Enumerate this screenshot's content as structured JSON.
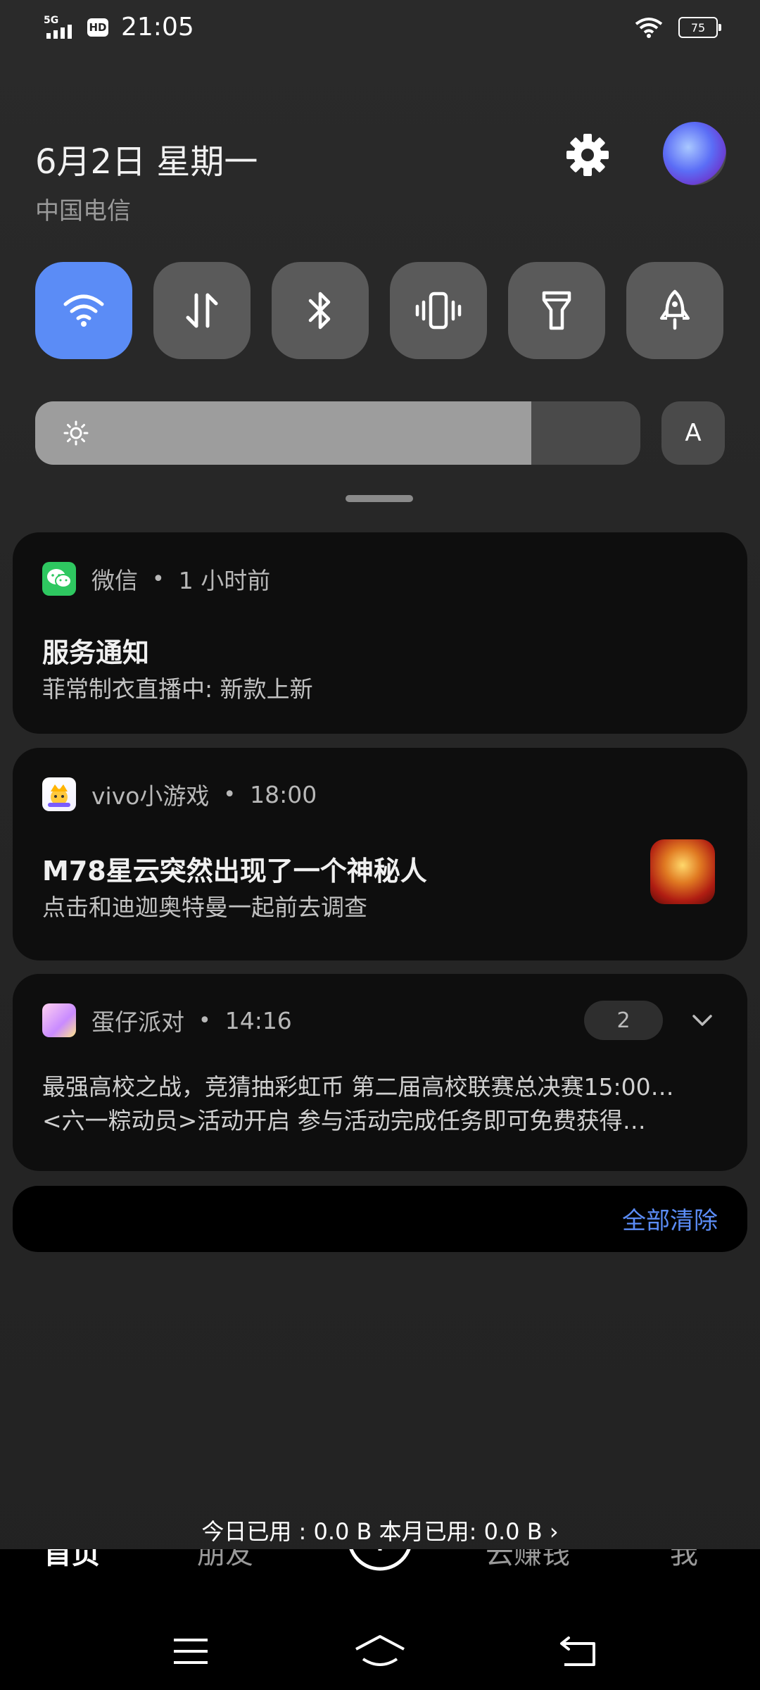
{
  "status_bar": {
    "network": "5G",
    "hd": "HD",
    "time": "21:05",
    "battery": "75"
  },
  "header": {
    "date": "6月2日 星期一",
    "carrier": "中国电信"
  },
  "quick_tiles": [
    {
      "name": "wifi",
      "active": true
    },
    {
      "name": "mobile-data",
      "active": false
    },
    {
      "name": "bluetooth",
      "active": false
    },
    {
      "name": "vibrate",
      "active": false
    },
    {
      "name": "flashlight",
      "active": false
    },
    {
      "name": "airplane-mode",
      "active": false
    }
  ],
  "brightness": {
    "level_percent": 82,
    "auto_label": "A"
  },
  "notifications": [
    {
      "app": "微信",
      "time": "1 小时前",
      "title": "服务通知",
      "body": "菲常制衣直播中: 新款上新"
    },
    {
      "app": "vivo小游戏",
      "time": "18:00",
      "title": "M78星云突然出现了一个神秘人",
      "body": "点击和迪迦奥特曼一起前去调查"
    },
    {
      "app": "蛋仔派对",
      "time": "14:16",
      "count": "2",
      "lines": [
        "最强高校之战，竞猜抽彩虹币  第二届高校联赛总决赛15:00…",
        "<六一粽动员>活动开启  参与活动完成任务即可免费获得…"
      ]
    }
  ],
  "clear_all": "全部清除",
  "data_usage": "今日已用 : 0.0 B 本月已用: 0.0 B ›",
  "background_app_tabs": [
    "首页",
    "朋友",
    "云赚钱",
    "我"
  ],
  "colors": {
    "accent": "#5b8cf6",
    "tile_inactive": "#5a5a5a",
    "card_bg": "#0e0e0e",
    "wechat_green": "#2ec760"
  }
}
